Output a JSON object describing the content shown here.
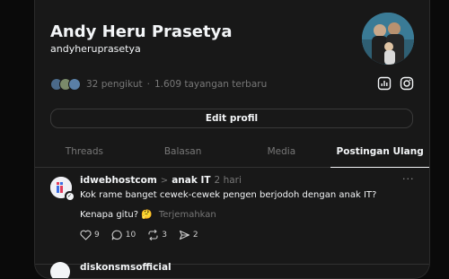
{
  "profile": {
    "display_name": "Andy Heru Prasetya",
    "username": "andyheruprasetya",
    "followers_text": "32 pengikut",
    "stats_sep": "·",
    "views_text": "1.609 tayangan terbaru",
    "edit_label": "Edit profil",
    "avatar_colors": [
      "#3a7b96",
      "#2a2a2a",
      "#c9b9a6"
    ],
    "follower_avatar_colors": [
      "#4b6a8a",
      "#7a8a6a",
      "#5a7fa6"
    ]
  },
  "tabs": [
    {
      "label": "Threads"
    },
    {
      "label": "Balasan"
    },
    {
      "label": "Media"
    },
    {
      "label": "Postingan Ulang",
      "active": true
    }
  ],
  "post": {
    "username": "idwebhostcom",
    "sep": ">",
    "topic": "anak IT",
    "time": "2 hari",
    "more": "···",
    "text_line1": "Kok rame banget cewek-cewek pengen berjodoh dengan anak IT?",
    "text_line2": "Kenapa gitu? 🤔",
    "translate_label": "Terjemahkan",
    "likes": "9",
    "comments": "10",
    "reposts": "3",
    "shares": "2"
  },
  "next_post": {
    "username": "diskonsmsofficial"
  },
  "colors": {
    "background": "#0a0a0a",
    "panel": "#181818",
    "text": "#f3f5f7",
    "muted": "#777777",
    "divider": "#323232"
  },
  "icons": [
    "chart-icon",
    "instagram-icon",
    "heart-icon",
    "comment-icon",
    "repost-icon",
    "share-icon",
    "more-icon"
  ]
}
